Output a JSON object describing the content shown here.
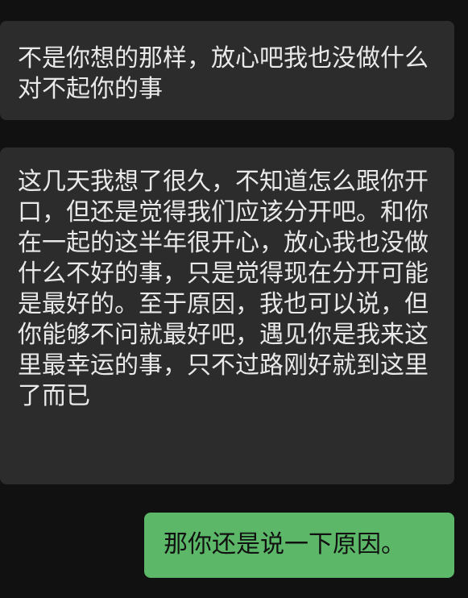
{
  "messages": [
    {
      "direction": "incoming",
      "text": "不是你想的那样，放心吧我也没做什么对不起你的事"
    },
    {
      "direction": "incoming",
      "text": "这几天我想了很久，不知道怎么跟你开口，但还是觉得我们应该分开吧。和你在一起的这半年很开心，放心我也没做什么不好的事，只是觉得现在分开可能是最好的。至于原因，我也可以说，但你能够不问就最好吧，遇见你是我来这里最幸运的事，只不过路刚好就到这里了而已"
    },
    {
      "direction": "outgoing",
      "text": "那你还是说一下原因。"
    }
  ],
  "colors": {
    "background": "#111111",
    "incoming_bubble": "#2c2c2c",
    "outgoing_bubble": "#5cb868",
    "incoming_text": "#e9e9e9",
    "outgoing_text": "#111111"
  }
}
